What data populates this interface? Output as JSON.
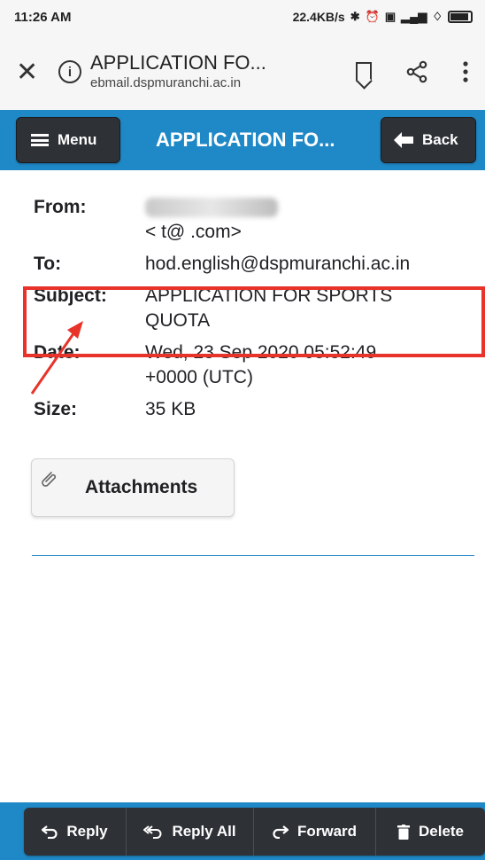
{
  "status_bar": {
    "time": "11:26 AM",
    "net_speed": "22.4KB/s"
  },
  "browser": {
    "title": "APPLICATION FO...",
    "url": "ebmail.dspmuranchi.ac.in",
    "icons": [
      "close-icon",
      "info-icon",
      "bookmark-icon",
      "share-icon",
      "more-vert-icon"
    ]
  },
  "app_bar": {
    "menu_label": "Menu",
    "title": "APPLICATION FO...",
    "back_label": "Back"
  },
  "message": {
    "from_label": "From:",
    "from_email": "<    t@     .com>",
    "to_label": "To:",
    "to_value": "hod.english@dspmuranchi.ac.in",
    "subject_label": "Subject:",
    "subject_line1": "APPLICATION FOR SPORTS",
    "subject_line2": "QUOTA",
    "date_label": "Date:",
    "date_line1": "Wed, 23 Sep 2020 05:52:49",
    "date_line2": "+0000 (UTC)",
    "size_label": "Size:",
    "size_value": "35 KB"
  },
  "attachments_label": "Attachments",
  "toolbar": {
    "reply": "Reply",
    "reply_all": "Reply All",
    "forward": "Forward",
    "delete": "Delete"
  },
  "colors": {
    "app_blue": "#1f88c7",
    "button_dark": "#2e3135",
    "highlight_red": "#e8332a"
  }
}
